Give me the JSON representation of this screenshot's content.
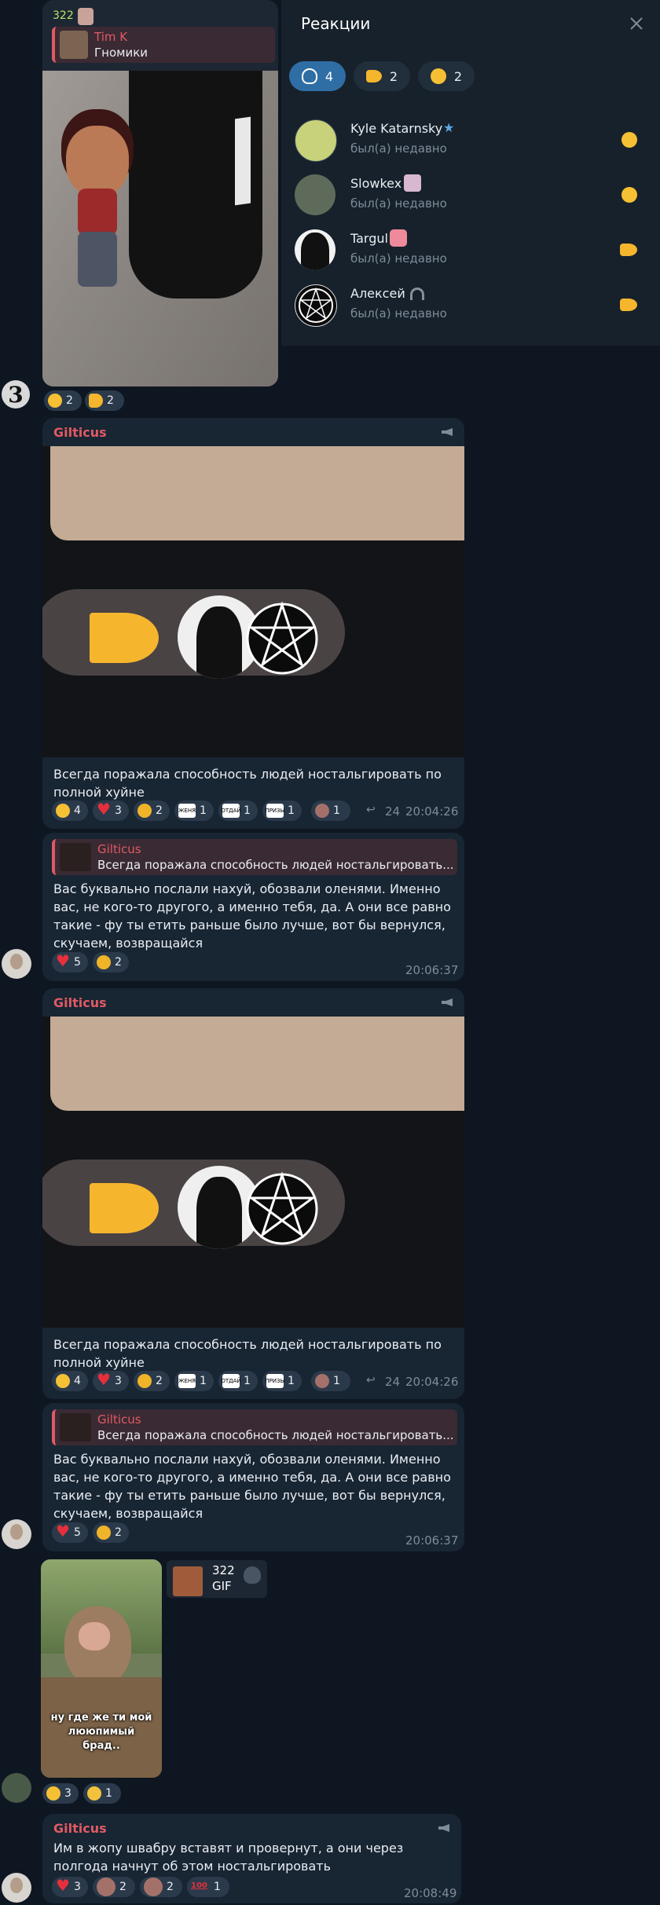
{
  "top_message": {
    "view_count": "322",
    "reply_author": "Tim K",
    "reply_text": "Гномики",
    "reactions": [
      {
        "icon": "smile-icon",
        "count": "2"
      },
      {
        "icon": "pointing-hand-icon",
        "count": "2"
      }
    ]
  },
  "reactions_panel": {
    "title": "Реакции",
    "close_icon": "close-icon",
    "tabs": [
      {
        "icon": "all-reactions-icon",
        "count": "4",
        "active": true
      },
      {
        "icon": "pointing-hand-icon",
        "count": "2",
        "active": false
      },
      {
        "icon": "smile-icon",
        "count": "2",
        "active": false
      }
    ],
    "users": [
      {
        "name": "Kyle Katarnsky",
        "status": "был(а) недавно",
        "reaction": "smile-icon",
        "badge": "star-icon"
      },
      {
        "name": "Slowkex",
        "status": "был(а) недавно",
        "reaction": "smile-icon",
        "badge": "sticker-icon"
      },
      {
        "name": "Targul",
        "status": "был(а) недавно",
        "reaction": "pointing-hand-icon",
        "badge": "pink-square-icon"
      },
      {
        "name": "Алексей",
        "status": "был(а) недавно",
        "reaction": "pointing-hand-icon",
        "badge": "headphones-icon"
      }
    ]
  },
  "messages": [
    {
      "author": "Gilticus",
      "text": "Всегда поражала способность людей ностальгировать по полной хуйне",
      "reactions": [
        {
          "type": "smile",
          "count": "4"
        },
        {
          "type": "heart",
          "count": "3"
        },
        {
          "type": "think",
          "count": "2"
        },
        {
          "type": "sticker",
          "label": "ЖЕНЯ",
          "count": "1"
        },
        {
          "type": "sticker",
          "label": "ОТДАЙ",
          "count": "1"
        },
        {
          "type": "sticker",
          "label": "ПРИЗЫ",
          "count": "1"
        },
        {
          "type": "face",
          "count": "1"
        }
      ],
      "forwards": "24",
      "time": "20:04:26"
    },
    {
      "reply_author": "Gilticus",
      "reply_text": "Всегда поражала способность людей ностальгировать...",
      "text": "Вас буквально послали нахуй, обозвали оленями. Именно вас, не кого-то другого, а именно тебя, да. А они все равно такие - фу ты етить раньше было лучше, вот бы вернулся, скучаем, возвращайся",
      "reactions": [
        {
          "type": "heart",
          "count": "5"
        },
        {
          "type": "think",
          "count": "2"
        }
      ],
      "time": "20:06:37"
    },
    {
      "author": "Gilticus",
      "text": "Всегда поражала способность людей ностальгировать по полной хуйне",
      "reactions": [
        {
          "type": "smile",
          "count": "4"
        },
        {
          "type": "heart",
          "count": "3"
        },
        {
          "type": "think",
          "count": "2"
        },
        {
          "type": "sticker",
          "label": "ЖЕНЯ",
          "count": "1"
        },
        {
          "type": "sticker",
          "label": "ОТДАЙ",
          "count": "1"
        },
        {
          "type": "sticker",
          "label": "ПРИЗЫ",
          "count": "1"
        },
        {
          "type": "face",
          "count": "1"
        }
      ],
      "forwards": "24",
      "time": "20:04:26"
    },
    {
      "reply_author": "Gilticus",
      "reply_text": "Всегда поражала способность людей ностальгировать...",
      "text": "Вас буквально послали нахуй, обозвали оленями. Именно вас, не кого-то другого, а именно тебя, да. А они все равно такие - фу ты етить раньше было лучше, вот бы вернулся, скучаем, возвращайся",
      "reactions": [
        {
          "type": "heart",
          "count": "5"
        },
        {
          "type": "think",
          "count": "2"
        }
      ],
      "time": "20:06:37"
    }
  ],
  "monkey_message": {
    "caption": "ну где же ти мой лююпимый брад..",
    "view_count": "322",
    "gif_label": "GIF",
    "reactions": [
      {
        "type": "smile",
        "count": "3"
      },
      {
        "type": "cry",
        "count": "1"
      }
    ]
  },
  "last_message": {
    "author": "Gilticus",
    "text": "Им в жопу швабру вставят и провернут, а они через полгода начнут об этом ностальгировать",
    "reactions": [
      {
        "type": "heart",
        "count": "3"
      },
      {
        "type": "face",
        "count": "2"
      },
      {
        "type": "face",
        "count": "2"
      },
      {
        "type": "hundred",
        "count": "1"
      }
    ],
    "time": "20:08:49"
  },
  "colors": {
    "background": "#0e1621",
    "bubble": "#182533",
    "author": "#e05a64",
    "accent": "#2f6ea5"
  }
}
